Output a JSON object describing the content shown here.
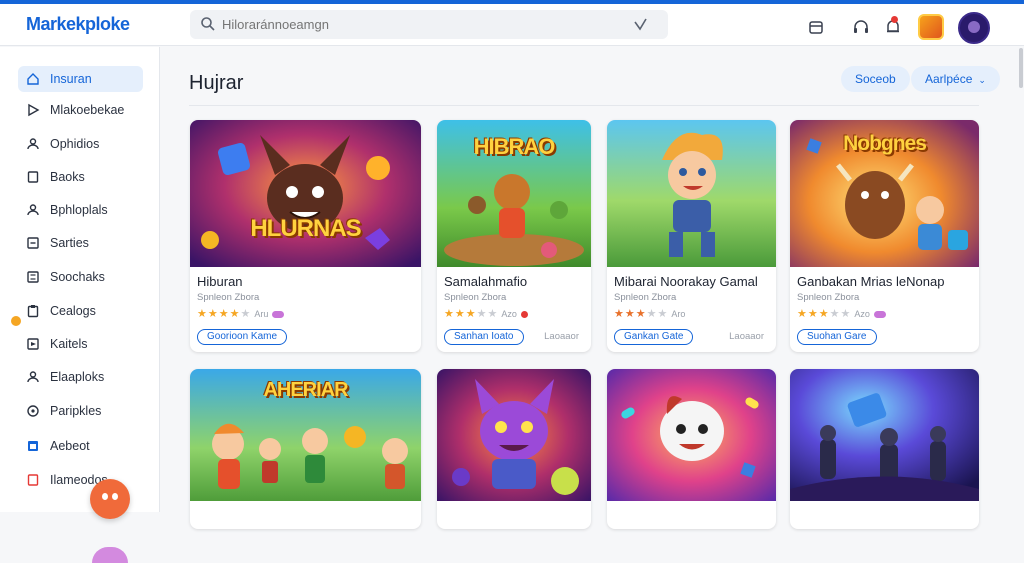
{
  "app": {
    "logo": "Markekploke",
    "search": {
      "placeholder": "Hiloraránnoeamgn"
    }
  },
  "header_icons": [
    "box-icon",
    "headset-icon",
    "bell-icon"
  ],
  "sidebar": {
    "items": [
      {
        "label": "Insuran",
        "icon": "home-icon",
        "active": true
      },
      {
        "label": "Mlakoebekae",
        "icon": "play-icon"
      },
      {
        "label": "Ophidios",
        "icon": "user-icon"
      },
      {
        "label": "Baoks",
        "icon": "book-icon"
      },
      {
        "label": "Bphloplals",
        "icon": "person-icon"
      },
      {
        "label": "Sarties",
        "icon": "list-icon"
      },
      {
        "label": "Soochaks",
        "icon": "tag-icon"
      },
      {
        "label": "Cealogs",
        "icon": "clipboard-icon"
      },
      {
        "label": "Kaitels",
        "icon": "flag-icon"
      },
      {
        "label": "Elaaploks",
        "icon": "person-icon"
      },
      {
        "label": "Paripkles",
        "icon": "settings-icon"
      },
      {
        "label": "Aebeot",
        "icon": "calendar-icon"
      },
      {
        "label": "Ilameodos",
        "icon": "document-icon"
      }
    ]
  },
  "main": {
    "title": "Hujrar",
    "filters": [
      {
        "label": "Soceob"
      },
      {
        "label": "Aarlpéce",
        "chevron": "⌄"
      }
    ]
  },
  "cards": [
    {
      "title": "Hiburan",
      "sub": "Spnleon Zbora",
      "rating": 4,
      "rating_text": "Aru",
      "button": "Goorioon Kame",
      "aside": "",
      "art_text": "HLURNAS",
      "art": "monster"
    },
    {
      "title": "Samalahmafio",
      "sub": "Spnleon Zbora",
      "rating": 3,
      "rating_text": "Azo",
      "button": "Sanhan Ioato",
      "aside": "Laoaaor",
      "art_text": "HIBRAO",
      "art": "bear"
    },
    {
      "title": "Mibarai Noorakay Gamal",
      "sub": "Spnleon Zbora",
      "rating": 3,
      "rating_text": "Aro",
      "button": "Gankan Gate",
      "aside": "Laoaaor",
      "art_text": "",
      "art": "boy"
    },
    {
      "title": "Ganbakan Mrias leNonap",
      "sub": "Spnleon Zbora",
      "rating": 3,
      "rating_text": "Azo",
      "button": "Suohan Gare",
      "aside": "",
      "art_text": "Nobgnes",
      "art": "bull"
    },
    {
      "title": "",
      "art_text": "AHERIAR",
      "art": "kids"
    },
    {
      "title": "",
      "art_text": "",
      "art": "cat"
    },
    {
      "title": "",
      "art_text": "",
      "art": "ghost"
    },
    {
      "title": "",
      "art_text": "",
      "art": "heroes"
    }
  ],
  "colors": {
    "accent": "#1565d8",
    "star": "#f5a623"
  }
}
